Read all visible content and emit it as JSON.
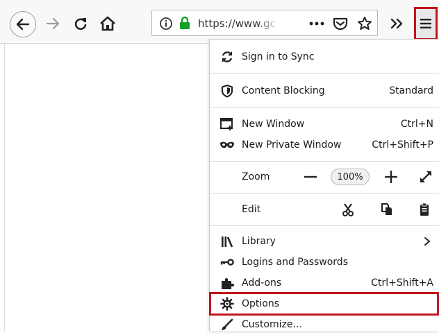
{
  "toolbar": {
    "url": "https://www.gc",
    "icons": {
      "back": "back-arrow-icon",
      "forward": "forward-arrow-icon",
      "reload": "reload-icon",
      "home": "home-icon",
      "info": "info-icon",
      "lock": "lock-icon",
      "page_actions": "more-dots-icon",
      "pocket": "pocket-icon",
      "bookmark": "star-icon",
      "overflow": "double-chevron-icon",
      "menu": "hamburger-menu-icon"
    }
  },
  "menu": {
    "sync": {
      "label": "Sign in to Sync",
      "icon": "sync-icon"
    },
    "content_blocking": {
      "label": "Content Blocking",
      "value": "Standard",
      "icon": "shield-icon"
    },
    "new_window": {
      "label": "New Window",
      "shortcut": "Ctrl+N",
      "icon": "new-window-icon"
    },
    "new_private_window": {
      "label": "New Private Window",
      "shortcut": "Ctrl+Shift+P",
      "icon": "mask-icon"
    },
    "zoom": {
      "label": "Zoom",
      "minus": "−",
      "level": "100%",
      "plus": "+",
      "icon": "fullscreen-icon"
    },
    "edit": {
      "label": "Edit",
      "icons": [
        "cut-icon",
        "copy-icon",
        "paste-icon"
      ]
    },
    "library": {
      "label": "Library",
      "icon": "library-icon"
    },
    "logins": {
      "label": "Logins and Passwords",
      "icon": "key-icon"
    },
    "addons": {
      "label": "Add-ons",
      "shortcut": "Ctrl+Shift+A",
      "icon": "puzzle-icon"
    },
    "options": {
      "label": "Options",
      "icon": "gear-icon"
    },
    "customize": {
      "label": "Customize...",
      "icon": "brush-icon"
    }
  },
  "colors": {
    "highlight_border": "#c0151b",
    "lock_green": "#12a025",
    "toolbar_bg": "#f8f8f8"
  }
}
